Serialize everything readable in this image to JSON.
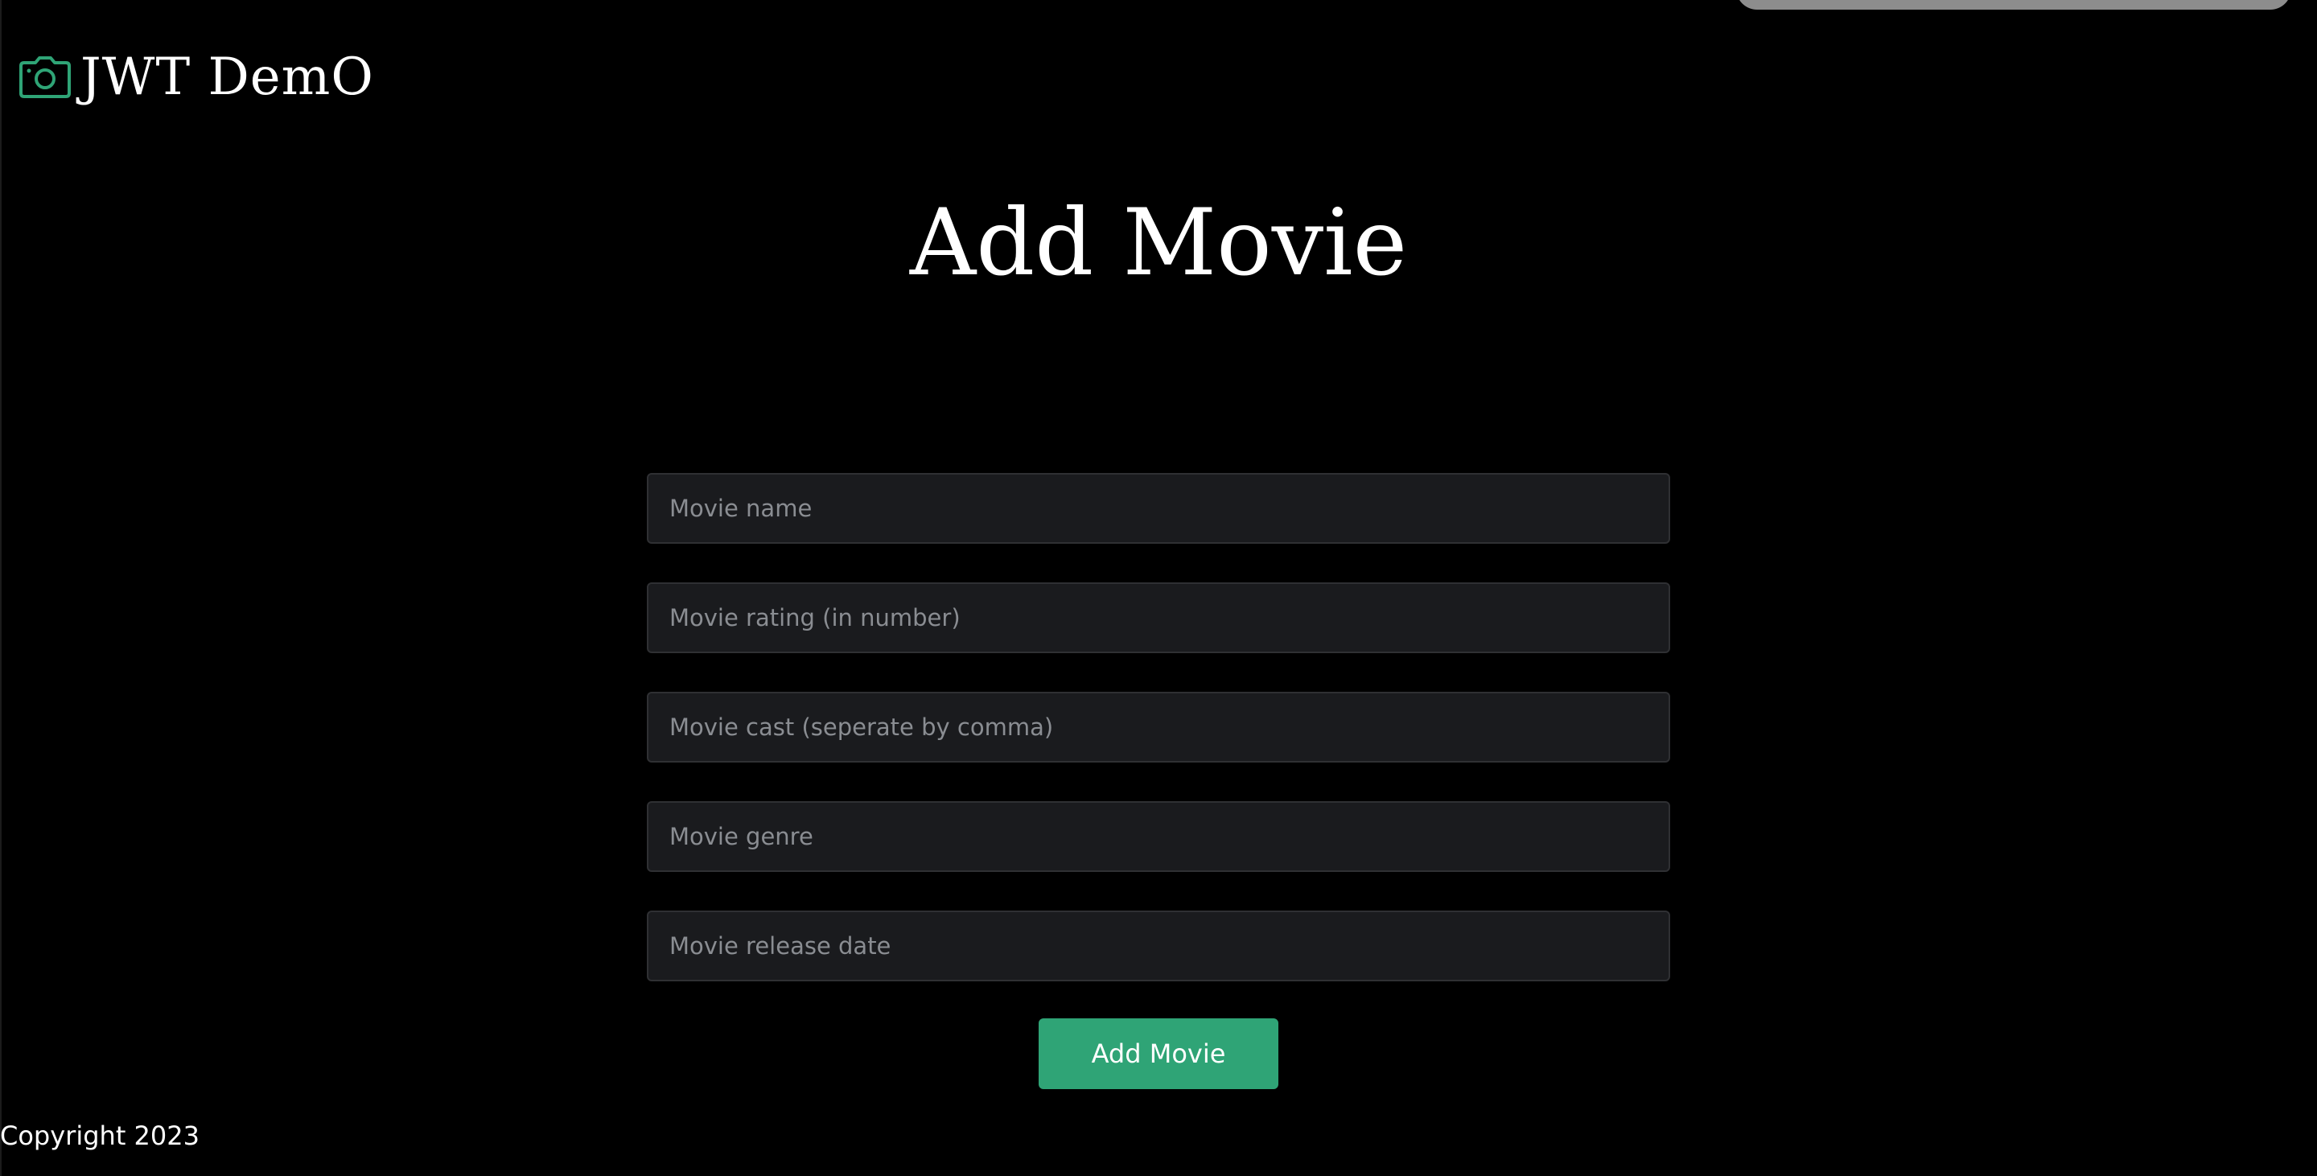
{
  "brand": {
    "title": "JWT DemO",
    "icon": "camera-icon"
  },
  "page": {
    "title": "Add Movie"
  },
  "form": {
    "fields": [
      {
        "placeholder": "Movie name",
        "value": ""
      },
      {
        "placeholder": "Movie rating (in number)",
        "value": ""
      },
      {
        "placeholder": "Movie cast (seperate by comma)",
        "value": ""
      },
      {
        "placeholder": "Movie genre",
        "value": ""
      },
      {
        "placeholder": "Movie release date",
        "value": ""
      }
    ],
    "submit_label": "Add Movie"
  },
  "footer": {
    "text": "Copyright 2023"
  },
  "colors": {
    "background": "#000000",
    "accent": "#2fa476",
    "input_background": "#1a1b1e",
    "input_border": "#2f3033",
    "placeholder": "#8a8d92"
  }
}
